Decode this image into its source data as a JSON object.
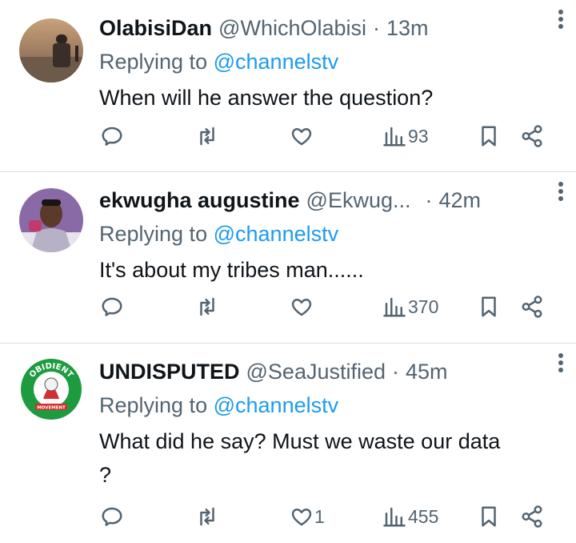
{
  "tweets": [
    {
      "name": "OlabisiDan",
      "handle": "@WhichOlabisi",
      "time": "13m",
      "replying_prefix": "Replying to",
      "replying_to": "@channelstv",
      "text": "When will he answer the question?",
      "likes": "",
      "views": "93"
    },
    {
      "name": "ekwugha augustine",
      "handle": "@Ekwug...",
      "time": "42m",
      "replying_prefix": "Replying to",
      "replying_to": "@channelstv",
      "text": "It's about my tribes man......",
      "likes": "",
      "views": "370"
    },
    {
      "name": "UNDISPUTED",
      "handle": "@SeaJustified",
      "time": "45m",
      "replying_prefix": "Replying to",
      "replying_to": "@channelstv",
      "text": "What did he say? Must we waste our data ?",
      "likes": "1",
      "views": "455",
      "avatar_logo_text": [
        "OBIDIENT",
        "MOVEMENT"
      ]
    }
  ],
  "colors": {
    "link": "#1d9bf0",
    "muted": "#536471",
    "text": "#0f1419",
    "divider": "#d8dee3",
    "logo_green": "#1e9a3f",
    "logo_red": "#d32f2f"
  },
  "icons": [
    "reply-icon",
    "retweet-icon",
    "like-icon",
    "views-icon",
    "bookmark-icon",
    "share-icon",
    "more-icon"
  ]
}
